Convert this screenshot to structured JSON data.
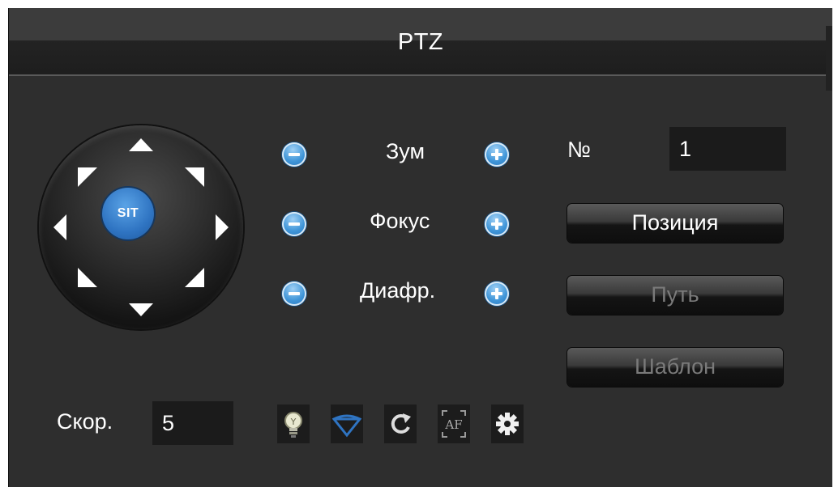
{
  "window": {
    "title": "PTZ"
  },
  "joystick": {
    "center_label": "SIT",
    "arrows": [
      "up",
      "up-right",
      "right",
      "down-right",
      "down",
      "down-left",
      "left",
      "up-left"
    ]
  },
  "controls": [
    {
      "label": "Зум",
      "minus": "minus-icon",
      "plus": "plus-icon"
    },
    {
      "label": "Фокус",
      "minus": "minus-icon",
      "plus": "plus-icon"
    },
    {
      "label": "Диафр.",
      "minus": "minus-icon",
      "plus": "plus-icon"
    }
  ],
  "preset": {
    "label": "№",
    "value": "1"
  },
  "buttons": [
    {
      "label": "Позиция",
      "state": "enabled"
    },
    {
      "label": "Путь",
      "state": "disabled"
    },
    {
      "label": "Шаблон",
      "state": "disabled"
    }
  ],
  "speed": {
    "label": "Скор.",
    "value": "5"
  },
  "toolbar": {
    "icons": [
      "light-icon",
      "wiper-icon",
      "rotate-icon",
      "af-icon",
      "settings-icon"
    ],
    "af_text": "AF",
    "accent": "#2f74c2"
  }
}
